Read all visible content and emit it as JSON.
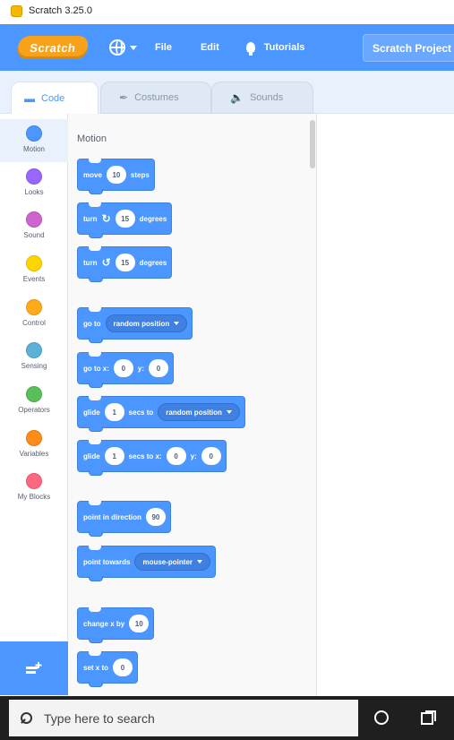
{
  "window": {
    "title": "Scratch 3.25.0",
    "icon": "scratch-app-icon"
  },
  "menubar": {
    "logo_text": "Scratch",
    "items": [
      {
        "label": "File"
      },
      {
        "label": "Edit"
      },
      {
        "label": "Tutorials"
      }
    ],
    "project_title": "Scratch Project",
    "background": "#4c97ff"
  },
  "tabs": [
    {
      "label": "Code",
      "icon": "code-icon",
      "active": true
    },
    {
      "label": "Costumes",
      "icon": "brush-icon",
      "active": false
    },
    {
      "label": "Sounds",
      "icon": "speaker-icon",
      "active": false
    }
  ],
  "categories": [
    {
      "label": "Motion",
      "color": "#4c97ff",
      "selected": true
    },
    {
      "label": "Looks",
      "color": "#9966ff",
      "selected": false
    },
    {
      "label": "Sound",
      "color": "#cf63cf",
      "selected": false
    },
    {
      "label": "Events",
      "color": "#ffd500",
      "selected": false
    },
    {
      "label": "Control",
      "color": "#ffab19",
      "selected": false
    },
    {
      "label": "Sensing",
      "color": "#5cb1d6",
      "selected": false
    },
    {
      "label": "Operators",
      "color": "#59c059",
      "selected": false
    },
    {
      "label": "Variables",
      "color": "#ff8c1a",
      "selected": false
    },
    {
      "label": "My Blocks",
      "color": "#ff6680",
      "selected": false
    }
  ],
  "palette": {
    "heading": "Motion",
    "blocks": {
      "move": {
        "t1": "move",
        "v1": "10",
        "t2": "steps"
      },
      "turn_right": {
        "t1": "turn",
        "v1": "15",
        "t2": "degrees"
      },
      "turn_left": {
        "t1": "turn",
        "v1": "15",
        "t2": "degrees"
      },
      "go_to": {
        "t1": "go to",
        "d1": "random position"
      },
      "go_to_xy": {
        "t1": "go to x:",
        "v1": "0",
        "t2": "y:",
        "v2": "0"
      },
      "glide_to": {
        "t1": "glide",
        "v1": "1",
        "t2": "secs to",
        "d1": "random position"
      },
      "glide_xy": {
        "t1": "glide",
        "v1": "1",
        "t2": "secs to x:",
        "v2": "0",
        "t3": "y:",
        "v3": "0"
      },
      "point_direction": {
        "t1": "point in direction",
        "v1": "90"
      },
      "point_towards": {
        "t1": "point towards",
        "d1": "mouse-pointer"
      },
      "change_x": {
        "t1": "change x by",
        "v1": "10"
      },
      "set_x": {
        "t1": "set x to",
        "v1": "0"
      }
    }
  },
  "taskbar": {
    "search_placeholder": "Type here to search"
  },
  "colors": {
    "motion_block": "#4c97ff",
    "menubar": "#4c97ff",
    "taskbar": "#1f1f1f"
  }
}
